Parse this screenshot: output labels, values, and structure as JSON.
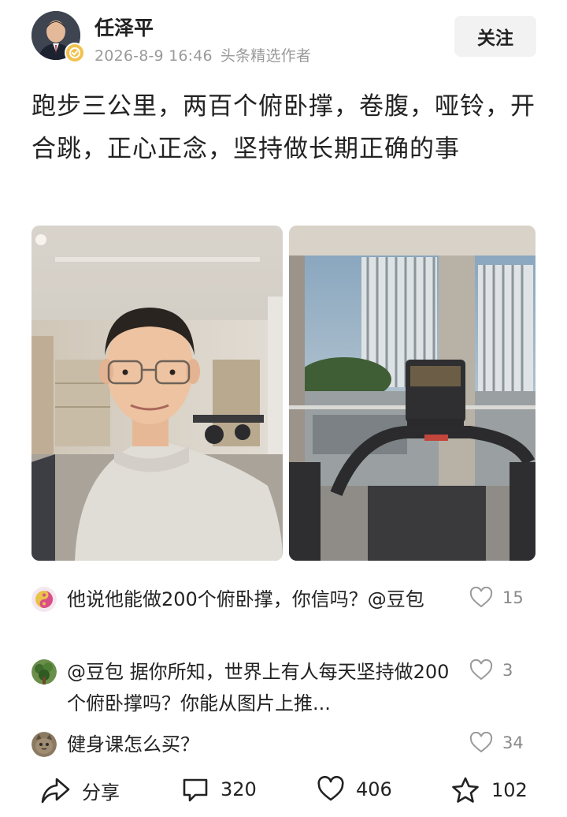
{
  "author": {
    "name": "任泽平",
    "date": "2026-8-9 16:46",
    "badge": "头条精选作者",
    "follow_label": "关注"
  },
  "post": {
    "text": "跑步三公里，两百个俯卧撑，卷腹，哑铃，开合跳，正心正念，坚持做长期正确的事"
  },
  "comments": [
    {
      "text": "他说他能做200个俯卧撑，你信吗？@豆包",
      "likes": "15",
      "avatar_icon": "yin-yang-avatar-icon"
    },
    {
      "text": "@豆包 据你所知，世界上有人每天坚持做200个俯卧撑吗？你能从图片上推...",
      "likes": "3",
      "avatar_icon": "plant-avatar-icon"
    },
    {
      "text": "健身课怎么买？",
      "likes": "34",
      "avatar_icon": "cat-avatar-icon"
    }
  ],
  "actions": {
    "share_label": "分享",
    "comments_count": "320",
    "likes_count": "406",
    "favorites_count": "102"
  },
  "colors": {
    "text_primary": "#222222",
    "text_secondary": "#9a9a9a",
    "follow_bg": "#f2f2f2",
    "verified_badge": "#f2c14e"
  }
}
